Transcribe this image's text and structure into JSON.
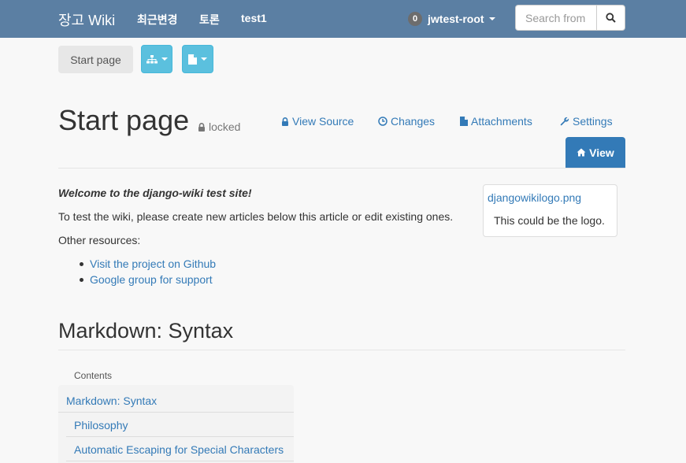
{
  "navbar": {
    "brand": "장고 Wiki",
    "links": [
      "최근변경",
      "토론",
      "test1"
    ],
    "notification_count": "0",
    "username": "jwtest-root",
    "search_placeholder": "Search from"
  },
  "toolbar": {
    "start_label": "Start page",
    "sitemap_icon": "sitemap-icon",
    "document_icon": "document-icon"
  },
  "header": {
    "title": "Start page",
    "locked_label": "locked",
    "tabs": [
      {
        "label": "View Source",
        "icon": "lock-icon"
      },
      {
        "label": "Changes",
        "icon": "clock-icon"
      },
      {
        "label": "Attachments",
        "icon": "file-icon"
      },
      {
        "label": "Settings",
        "icon": "wrench-icon"
      }
    ],
    "view_label": "View"
  },
  "article": {
    "intro": "Welcome to the django-wiki test site!",
    "para1": "To test the wiki, please create new articles below this article or edit existing ones.",
    "para2": "Other resources:",
    "resources": [
      "Visit the project on Github",
      "Google group for support"
    ],
    "figure": {
      "filename": "djangowikilogo.png",
      "caption": "This could be the logo."
    },
    "heading": "Markdown: Syntax"
  },
  "toc": {
    "label": "Contents",
    "items": [
      "Markdown: Syntax",
      "Philosophy",
      "Automatic Escaping for Special Characters"
    ]
  },
  "colors": {
    "navbar": "#5b7fa3",
    "link": "#337ab7",
    "info_button": "#5bc0de",
    "primary_button": "#337ab7"
  }
}
